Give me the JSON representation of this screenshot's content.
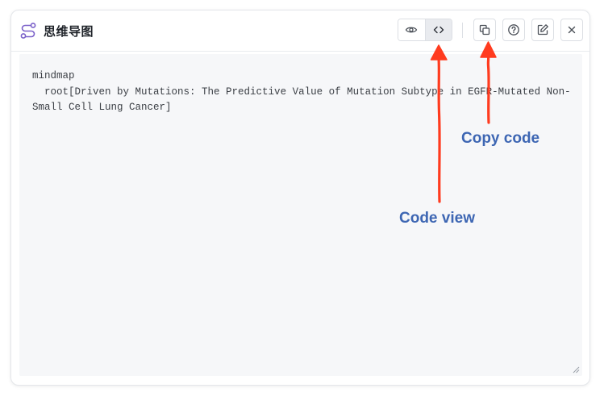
{
  "panel": {
    "title": "思维导图",
    "icon": "flow-path-icon"
  },
  "toolbar": {
    "preview_icon": "eye-icon",
    "code_view_icon": "code-icon",
    "active_view": "code",
    "copy_icon": "copy-icon",
    "help_icon": "help-circle-icon",
    "edit_icon": "edit-icon",
    "close_icon": "close-icon"
  },
  "editor": {
    "code": "mindmap\n  root[Driven by Mutations: The Predictive Value of Mutation Subtype in EGFR-Mutated Non-Small Cell Lung Cancer]"
  },
  "annotations": {
    "code_view": "Code view",
    "copy_code": "Copy code",
    "color": "#3d66b3",
    "arrow_color": "#ff3b1f"
  },
  "colors": {
    "editor_bg": "#f6f7f9",
    "active_toggle_bg": "#e9ebef",
    "border": "#dcdfe4",
    "title_icon": "#7b61c9"
  }
}
